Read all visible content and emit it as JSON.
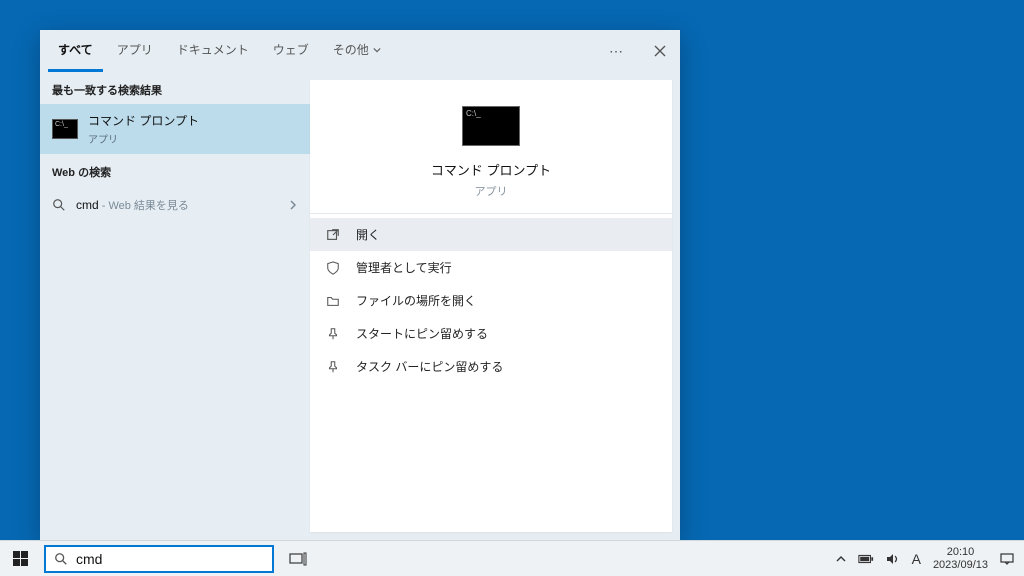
{
  "tabs": {
    "all": "すべて",
    "apps": "アプリ",
    "docs": "ドキュメント",
    "web": "ウェブ",
    "other": "その他"
  },
  "sections": {
    "best_match": "最も一致する検索結果",
    "web_search": "Web の検索"
  },
  "best_match_item": {
    "title": "コマンド プロンプト",
    "subtitle": "アプリ"
  },
  "web_item": {
    "query": "cmd",
    "aux": " - Web 結果を見る"
  },
  "preview": {
    "title": "コマンド プロンプト",
    "subtitle": "アプリ"
  },
  "actions": {
    "open": "開く",
    "run_admin": "管理者として実行",
    "open_location": "ファイルの場所を開く",
    "pin_start": "スタートにピン留めする",
    "pin_taskbar": "タスク バーにピン留めする"
  },
  "taskbar": {
    "search_value": "cmd"
  },
  "tray": {
    "ime": "A",
    "time": "20:10",
    "date": "2023/09/13"
  }
}
